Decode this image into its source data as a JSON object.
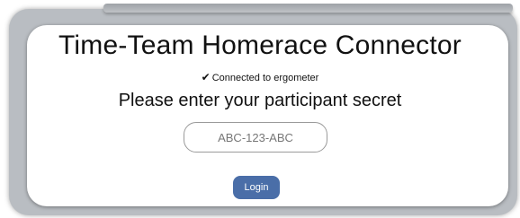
{
  "app": {
    "title": "Time-Team Homerace Connector"
  },
  "status": {
    "icon": "check-icon",
    "text": "Connected to ergometer"
  },
  "prompt": {
    "text": "Please enter your participant secret"
  },
  "secret_input": {
    "value": "",
    "placeholder": "ABC-123-ABC"
  },
  "login": {
    "label": "Login",
    "color": "#4a6ea8"
  }
}
